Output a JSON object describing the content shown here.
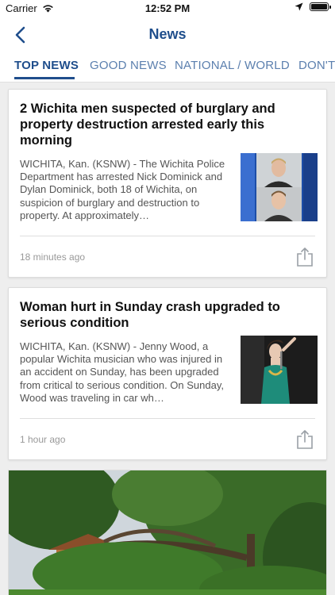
{
  "status_bar": {
    "carrier": "Carrier",
    "time": "12:52 PM",
    "battery_level": 1.0
  },
  "nav": {
    "title": "News",
    "back_icon": "chevron-left-icon"
  },
  "tabs": [
    {
      "label": "TOP NEWS",
      "active": true
    },
    {
      "label": "GOOD NEWS",
      "active": false
    },
    {
      "label": "NATIONAL / WORLD",
      "active": false
    },
    {
      "label": "DON'T",
      "active": false
    }
  ],
  "articles": [
    {
      "title": "2 Wichita men suspected of burglary and property destruction arrested early this morning",
      "excerpt": "WICHITA, Kan. (KSNW) - The Wichita Police Department has arrested Nick Dominick and Dylan Dominick, both 18 of Wichita, on suspicion of burglary and destruction to property. At approximately…",
      "time": "18 minutes ago",
      "share_icon": "share-icon"
    },
    {
      "title": "Woman hurt in Sunday crash upgraded to serious condition",
      "excerpt": "WICHITA, Kan. (KSNW) - Jenny Wood, a popular Wichita musician who was injured in an accident on Sunday, has been upgraded from critical to serious condition. On Sunday, Wood was traveling in car wh…",
      "time": "1 hour ago",
      "share_icon": "share-icon"
    }
  ],
  "colors": {
    "accent": "#1f4e8c",
    "tab_inactive": "#5b7fae"
  }
}
